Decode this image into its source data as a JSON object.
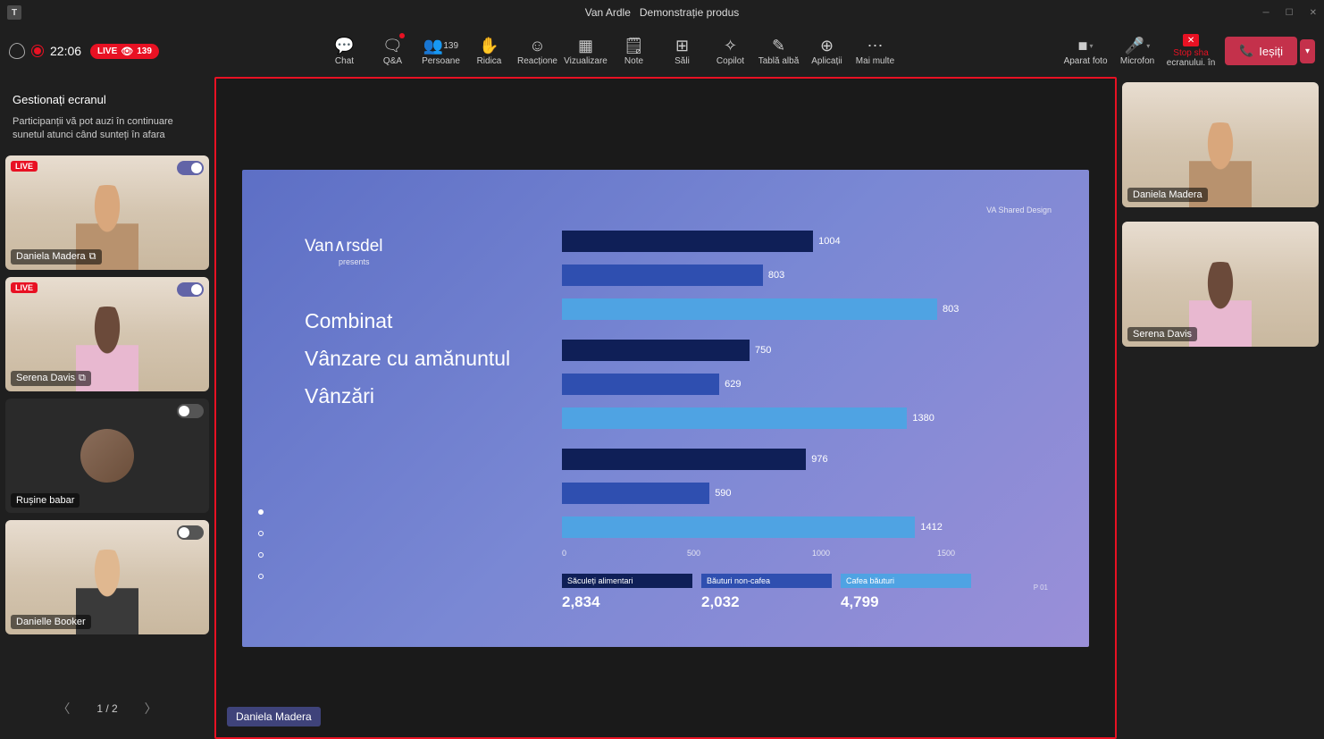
{
  "title": {
    "org": "Van Ardle",
    "meeting": "Demonstrație produs"
  },
  "timer": "22:06",
  "live_pill": {
    "label": "LIVE",
    "count": "139"
  },
  "toolbar": [
    {
      "id": "chat",
      "label": "Chat",
      "icon": "💬"
    },
    {
      "id": "qa",
      "label": "Q&A",
      "icon": "🗨",
      "dot": true
    },
    {
      "id": "people",
      "label": "Persoane",
      "icon": "👥",
      "count": "139"
    },
    {
      "id": "raise",
      "label": "Ridica",
      "icon": "✋"
    },
    {
      "id": "react",
      "label": "Reacțione",
      "icon": "☺"
    },
    {
      "id": "view",
      "label": "Vizualizare",
      "icon": "▦"
    },
    {
      "id": "notes",
      "label": "Note",
      "icon": "🗒"
    },
    {
      "id": "rooms",
      "label": "Săli",
      "icon": "⊞"
    },
    {
      "id": "copilot",
      "label": "Copilot",
      "icon": "✧"
    },
    {
      "id": "whiteboard",
      "label": "Tablă albă",
      "icon": "✎"
    },
    {
      "id": "apps",
      "label": "Aplicații",
      "icon": "⊕"
    },
    {
      "id": "more",
      "label": "Mai multe",
      "icon": "⋯"
    }
  ],
  "camera": {
    "label": "Aparat foto"
  },
  "mic": {
    "label": "Microfon"
  },
  "stop_share": {
    "label": "Stop sha",
    "sub": "ecranului. în"
  },
  "leave": "Ieșiți",
  "left_panel": {
    "title": "Gestionați ecranul",
    "subtitle": "Participanții vă pot auzi în continuare sunetul atunci când sunteți în afara"
  },
  "participants": [
    {
      "name": "Daniela Madera",
      "live": true,
      "toggle": true,
      "share_icon": true,
      "bg": "p1"
    },
    {
      "name": "Serena Davis",
      "live": true,
      "toggle": true,
      "share_icon": true,
      "bg": "p2"
    },
    {
      "name": "Rușine babar",
      "live": false,
      "toggle": false,
      "circle": true
    },
    {
      "name": "Danielle Booker",
      "live": false,
      "toggle": false,
      "bg": "p4"
    }
  ],
  "pager": {
    "current": "1 / 2"
  },
  "presenter": "Daniela  Madera",
  "right_thumbs": [
    {
      "name": "Daniela Madera",
      "bg": "p1"
    },
    {
      "name": "Serena Davis",
      "bg": "p2"
    }
  ],
  "slide": {
    "brand": "VanArsdel",
    "brand_sub": "presents",
    "corner": "VA Shared Design",
    "lines": [
      "Combinat",
      "Vânzare cu amănuntul",
      "Vânzări"
    ],
    "page": "P 01"
  },
  "chart_data": {
    "type": "bar",
    "orientation": "horizontal",
    "groups": [
      "Combinat",
      "Vânzare cu amănuntul",
      "Vânzări"
    ],
    "series": [
      {
        "name": "Săculeți alimentari",
        "color": "#0f1f57",
        "values": [
          1004,
          750,
          976
        ]
      },
      {
        "name": "Băuturi non-cafea",
        "color": "#2f4fb0",
        "values": [
          803,
          629,
          590
        ]
      },
      {
        "name": "Cafea băuturi",
        "color": "#4fa3e3",
        "values": [
          803,
          1380,
          1412
        ]
      }
    ],
    "x_ticks": [
      0,
      500,
      1000,
      1500
    ],
    "xlim": [
      0,
      1500
    ],
    "third_bar_label_override": {
      "group": 0,
      "label": "803",
      "actual_width": 1500
    },
    "legend": [
      "Săculeți alimentari",
      "Băuturi non-cafea",
      "Cafea băuturi"
    ],
    "totals": [
      "2,834",
      "2,032",
      "4,799"
    ]
  }
}
